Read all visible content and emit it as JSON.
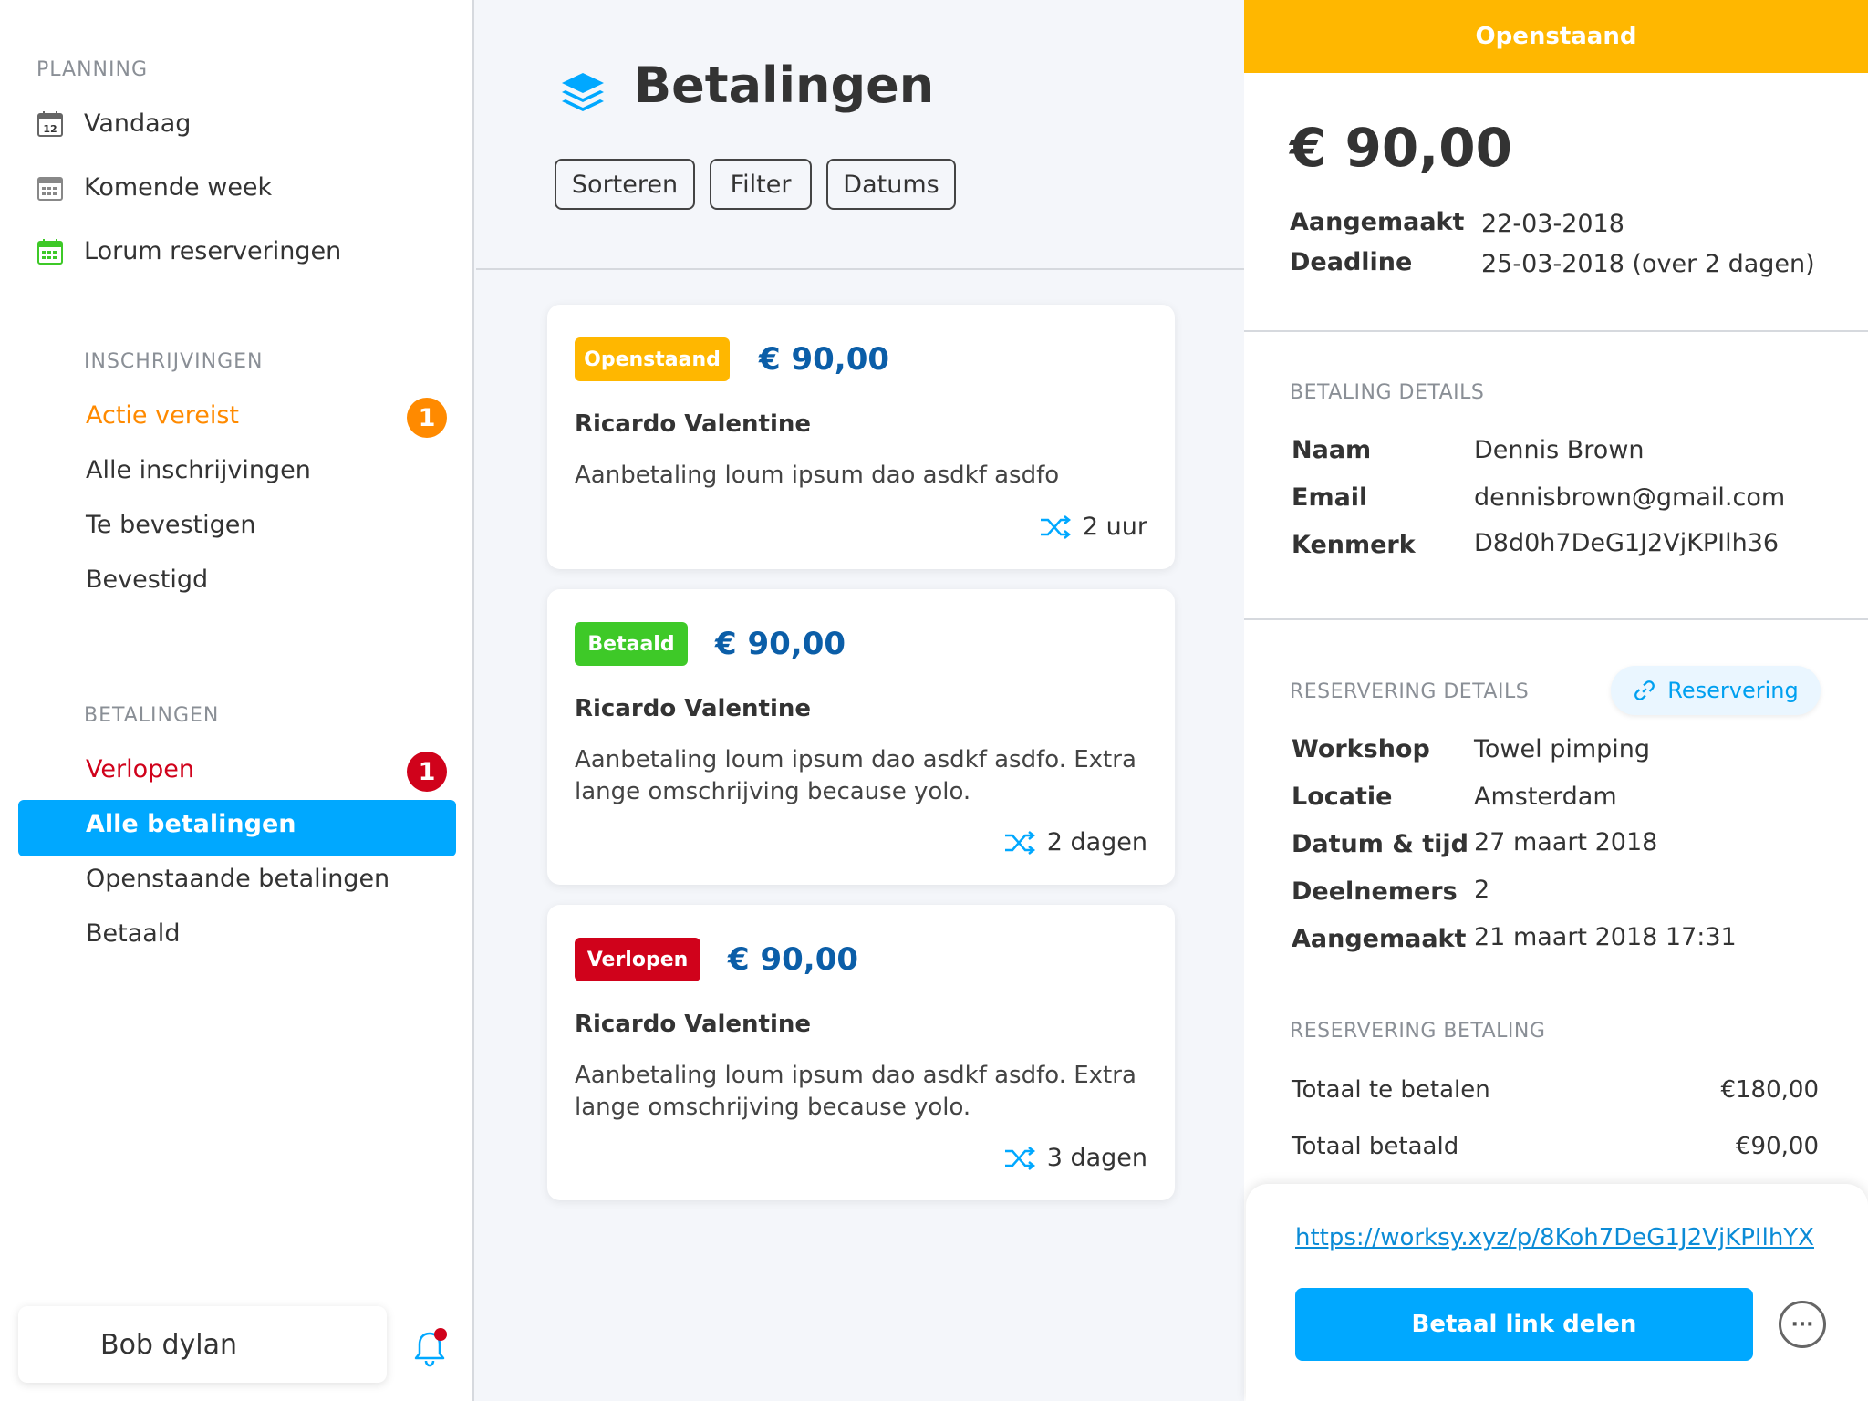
{
  "sidebar": {
    "planning_title": "PLANNING",
    "planning_items": [
      {
        "label": "Vandaag",
        "icon": "calendar-day-icon",
        "date_label": "12"
      },
      {
        "label": "Komende week",
        "icon": "calendar-week-icon"
      },
      {
        "label": "Lorum reserveringen",
        "icon": "calendar-green-icon"
      }
    ],
    "inschrijvingen_title": "INSCHRIJVINGEN",
    "inschrijvingen_items": [
      {
        "label": "Actie vereist",
        "badge": "1"
      },
      {
        "label": "Alle inschrijvingen"
      },
      {
        "label": "Te bevestigen"
      },
      {
        "label": "Bevestigd"
      }
    ],
    "betalingen_title": "BETALINGEN",
    "betalingen_items": [
      {
        "label": "Verlopen",
        "badge": "1"
      },
      {
        "label": "Alle betalingen"
      },
      {
        "label": "Openstaande betalingen"
      },
      {
        "label": "Betaald"
      }
    ],
    "user_name": "Bob dylan"
  },
  "main": {
    "title": "Betalingen",
    "filters": [
      "Sorteren",
      "Filter",
      "Datums"
    ],
    "payments": [
      {
        "status": "Openstaand",
        "amount": "€ 90,00",
        "name": "Ricardo Valentine",
        "description": "Aanbetaling loum ipsum dao asdkf asdfo",
        "time": "2 uur"
      },
      {
        "status": "Betaald",
        "amount": "€ 90,00",
        "name": "Ricardo Valentine",
        "description": "Aanbetaling loum ipsum dao asdkf asdfo. Extra lange omschrijving because yolo.",
        "time": "2 dagen"
      },
      {
        "status": "Verlopen",
        "amount": "€ 90,00",
        "name": "Ricardo Valentine",
        "description": "Aanbetaling loum ipsum dao asdkf asdfo. Extra lange omschrijving because yolo.",
        "time": "3 dagen"
      }
    ]
  },
  "detail": {
    "status": "Openstaand",
    "amount": "€ 90,00",
    "created_label": "Aangemaakt",
    "created_value": "22-03-2018",
    "deadline_label": "Deadline",
    "deadline_value": "25-03-2018 (over 2 dagen)",
    "betaling_title": "BETALING DETAILS",
    "betaling": [
      {
        "label": "Naam",
        "value": "Dennis Brown"
      },
      {
        "label": "Email",
        "value": "dennisbrown@gmail.com"
      },
      {
        "label": "Kenmerk",
        "value": "D8d0h7DeG1J2VjKPIlh36"
      }
    ],
    "reservering_title": "RESERVERING DETAILS",
    "reservering_button": "Reservering",
    "reservering": [
      {
        "label": "Workshop",
        "value": "Towel pimping"
      },
      {
        "label": "Locatie",
        "value": "Amsterdam"
      },
      {
        "label": "Datum & tijd",
        "value": "27 maart 2018"
      },
      {
        "label": "Deelnemers",
        "value": "2"
      },
      {
        "label": "Aangemaakt",
        "value": "21 maart 2018 17:31"
      }
    ],
    "res_betaling_title": "RESERVERING BETALING",
    "totals": [
      {
        "label": "Totaal te betalen",
        "value": "€180,00"
      },
      {
        "label": "Totaal betaald",
        "value": "€90,00"
      }
    ],
    "pay_link": "https://worksy.xyz/p/8Koh7DeG1J2VjKPIlhYX",
    "share_button": "Betaal link delen",
    "more_button": "···"
  },
  "colors": {
    "accent": "#00a8ff",
    "openstaand": "#ffb700",
    "betaald": "#3ec928",
    "verlopen": "#d0021b",
    "action_orange": "#ff8a00",
    "amount_blue": "#0b5ea8"
  }
}
